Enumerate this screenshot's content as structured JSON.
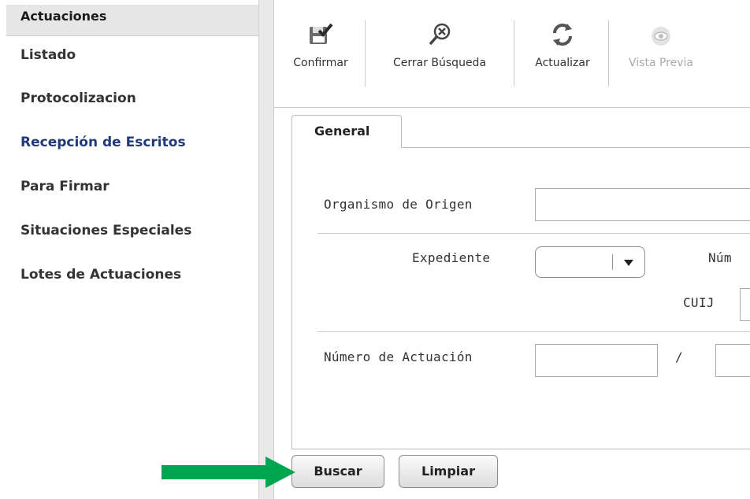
{
  "sidebar": {
    "header": "Actuaciones",
    "items": [
      {
        "label": "Listado"
      },
      {
        "label": "Protocolizacion"
      },
      {
        "label": "Recepción de Escritos"
      },
      {
        "label": "Para Firmar"
      },
      {
        "label": "Situaciones Especiales"
      },
      {
        "label": "Lotes de Actuaciones"
      }
    ],
    "active_index": 2
  },
  "toolbar": {
    "buttons": [
      {
        "label": "Confirmar",
        "icon": "save-check-icon",
        "enabled": true
      },
      {
        "label": "Cerrar Búsqueda",
        "icon": "close-search-icon",
        "enabled": true
      },
      {
        "label": "Actualizar",
        "icon": "refresh-icon",
        "enabled": true
      },
      {
        "label": "Vista Previa",
        "icon": "eye-icon",
        "enabled": false
      }
    ]
  },
  "tabs": [
    {
      "label": "General"
    }
  ],
  "form": {
    "organismo_label": "Organismo de Origen",
    "organismo_value": "",
    "expediente_label": "Expediente",
    "expediente_value": "",
    "numero_label_partial": "Núm",
    "cuij_label": "CUIJ",
    "numero_actuacion_label": "Número de Actuación",
    "numero_actuacion_value": "",
    "separator": "/",
    "anio_value": ""
  },
  "actions": {
    "search_label": "Buscar",
    "clear_label": "Limpiar"
  },
  "colors": {
    "active_item": "#1f3a78",
    "annotation_arrow": "#00a550"
  }
}
